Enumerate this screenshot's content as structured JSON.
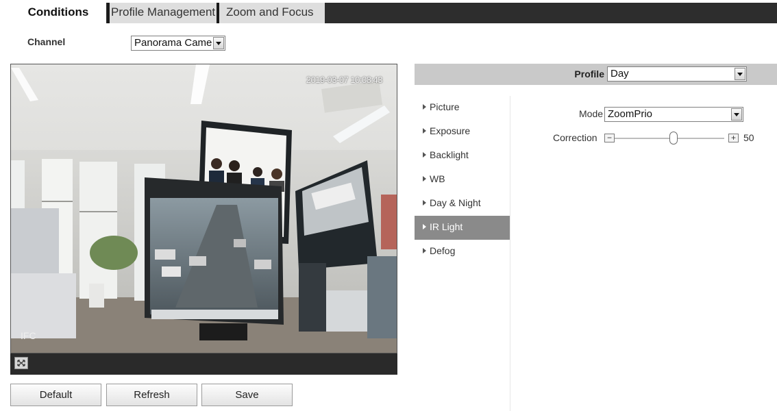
{
  "tabs": [
    {
      "label": "Conditions",
      "active": true
    },
    {
      "label": "Profile Management",
      "active": false
    },
    {
      "label": "Zoom and Focus",
      "active": false
    }
  ],
  "channel": {
    "label": "Channel",
    "value": "Panorama Came"
  },
  "video": {
    "timestamp": "2019-03-07 10:08:43",
    "corner_label": "IFC"
  },
  "buttons": {
    "default": "Default",
    "refresh": "Refresh",
    "save": "Save"
  },
  "profile": {
    "label": "Profile",
    "value": "Day"
  },
  "menu": {
    "items": [
      {
        "label": "Picture"
      },
      {
        "label": "Exposure"
      },
      {
        "label": "Backlight"
      },
      {
        "label": "WB"
      },
      {
        "label": "Day & Night"
      },
      {
        "label": "IR Light"
      },
      {
        "label": "Defog"
      }
    ],
    "active": "IR Light"
  },
  "ir_light": {
    "mode_label": "Mode",
    "mode_value": "ZoomPrio",
    "correction_label": "Correction",
    "correction_value": "50",
    "minus": "−",
    "plus": "+"
  },
  "colors": {
    "tab_bar": "#2d2d2d",
    "panel_header": "#c9c9c9",
    "active_menu": "#8a8a8a"
  }
}
